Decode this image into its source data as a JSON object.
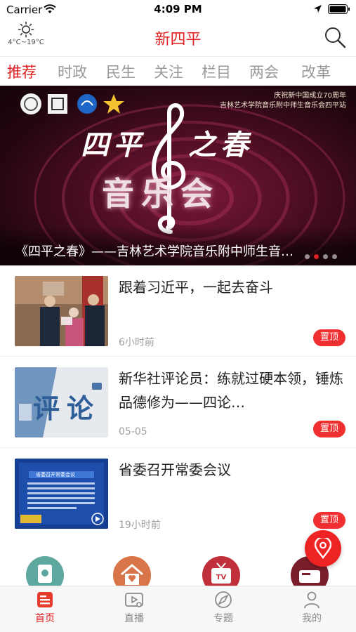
{
  "status_bar": {
    "carrier": "Carrier",
    "time": "4:09 PM"
  },
  "header": {
    "app_title": "新四平",
    "weather_temp": "4°C~19°C",
    "weather_icon": "sun-icon",
    "search_icon": "search-icon"
  },
  "tabs": [
    {
      "label": "推荐",
      "active": true
    },
    {
      "label": "时政",
      "active": false
    },
    {
      "label": "民生",
      "active": false
    },
    {
      "label": "关注",
      "active": false
    },
    {
      "label": "栏目",
      "active": false
    },
    {
      "label": "两会",
      "active": false
    },
    {
      "label": "改革",
      "active": false
    }
  ],
  "banner": {
    "topline_1": "庆祝新中国成立70周年",
    "topline_2": "吉林艺术学院音乐附中师生音乐会四平站",
    "headline_left": "四平",
    "headline_right": "之春",
    "headline_bottom": "音乐会",
    "caption": "《四平之春》——吉林艺术学院音乐附中师生音乐会四平站",
    "slide_count": 4,
    "active_slide": 2
  },
  "news": [
    {
      "title": "跟着习近平，一起去奋斗",
      "time": "6小时前",
      "pin": "置顶",
      "thumb": "photo"
    },
    {
      "title": "新华社评论员：练就过硬本领，锤炼品德修为——四论…",
      "time": "05-05",
      "pin": "置顶",
      "thumb": "commentary",
      "thumb_text": "评论"
    },
    {
      "title": "省委召开常委会议",
      "time": "19小时前",
      "pin": "置顶",
      "thumb": "screen",
      "thumb_text": "省委召开常委会议"
    }
  ],
  "colors": {
    "accent": "#e02020",
    "pin_badge": "#f03030",
    "service_1": "#5fa8a0",
    "service_2": "#d8764a",
    "service_3": "#c0303a",
    "service_4": "#7a1d2a"
  },
  "tabbar": [
    {
      "label": "首页",
      "icon": "home-news-icon",
      "active": true
    },
    {
      "label": "直播",
      "icon": "live-video-icon",
      "active": false
    },
    {
      "label": "专题",
      "icon": "topic-compass-icon",
      "active": false
    },
    {
      "label": "我的",
      "icon": "profile-icon",
      "active": false
    }
  ],
  "fab_icon": "location-pin-icon"
}
